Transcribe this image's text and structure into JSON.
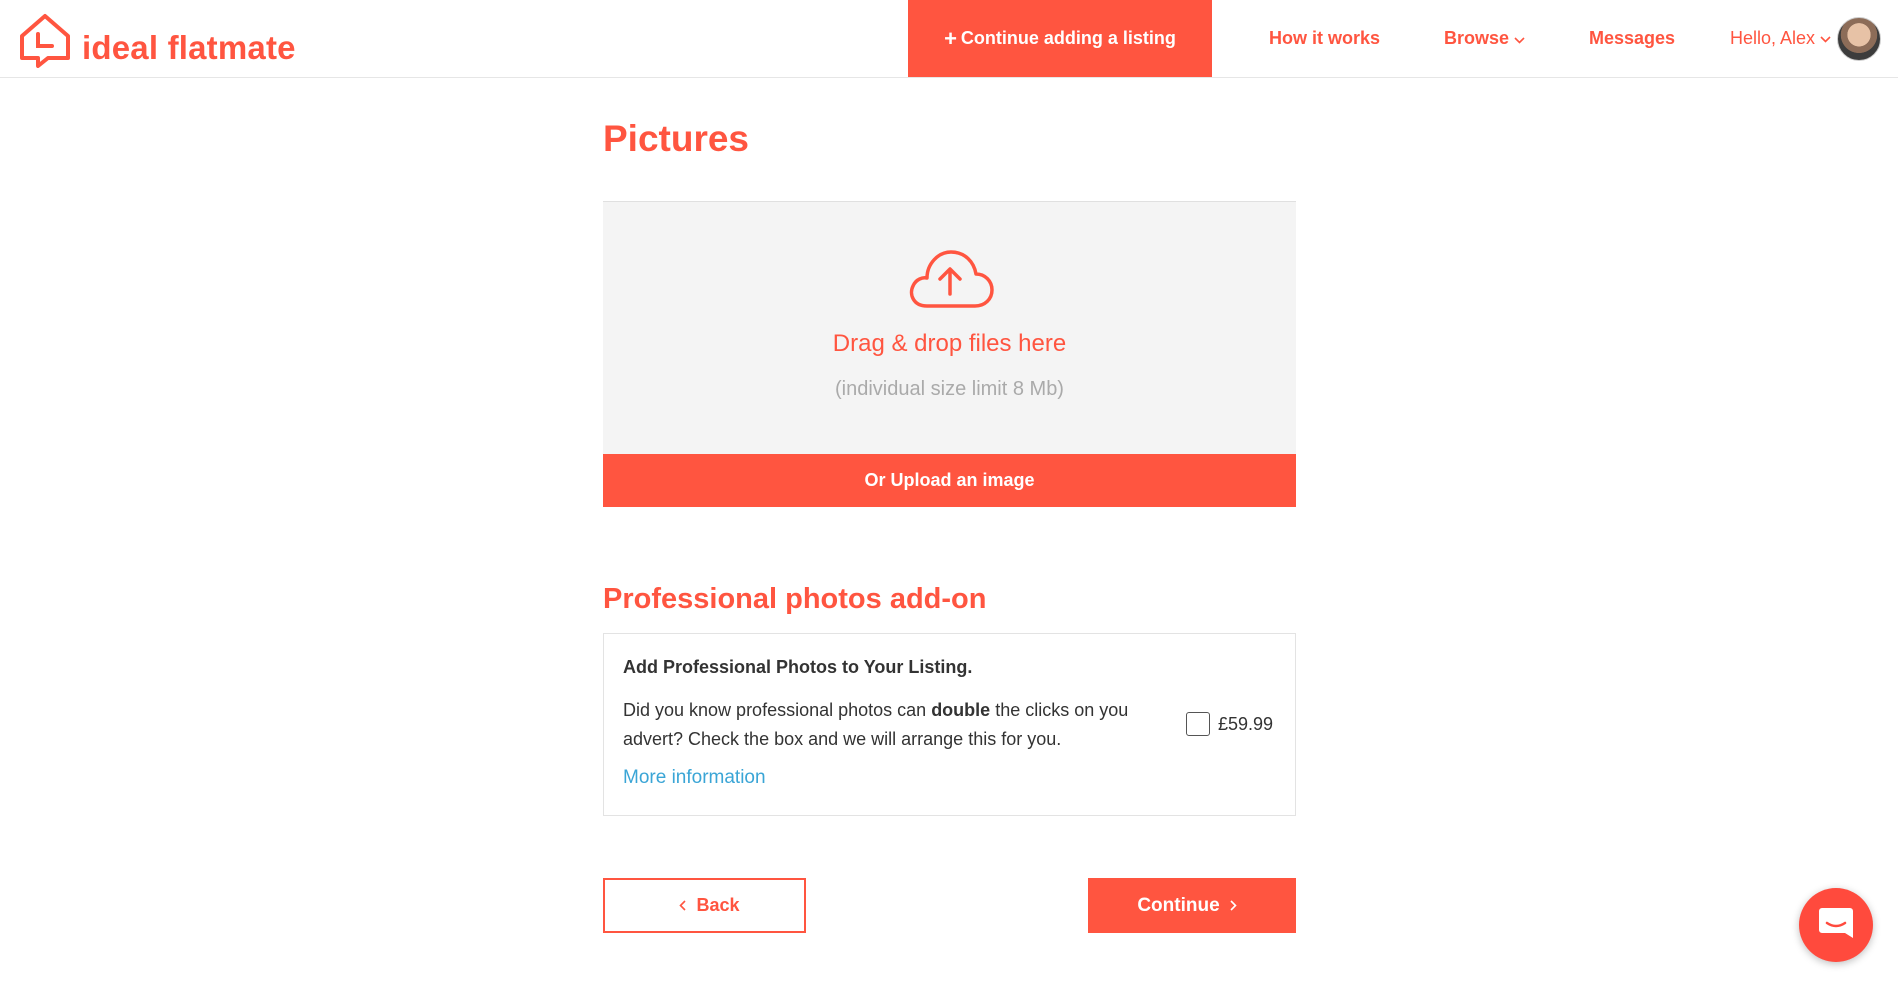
{
  "header": {
    "logo_text": "ideal flatmate",
    "cta_label": "Continue adding a listing",
    "nav": {
      "how_it_works": "How it works",
      "browse": "Browse",
      "messages": "Messages"
    },
    "user_label": "Hello, Alex"
  },
  "page": {
    "title": "Pictures",
    "dropzone": {
      "title": "Drag & drop files here",
      "subtitle": "(individual size limit 8 Mb)"
    },
    "upload_button": "Or Upload an image"
  },
  "addon": {
    "section_title": "Professional photos add-on",
    "heading": "Add Professional Photos to Your Listing.",
    "desc_before": "Did you know professional photos can ",
    "desc_bold": "double",
    "desc_after": " the clicks on you advert? Check the box and we will arrange this for you.",
    "link": "More information",
    "price": "£59.99",
    "checked": false
  },
  "actions": {
    "back": "Back",
    "continue": "Continue"
  },
  "colors": {
    "brand": "#ff5540",
    "link": "#3aa5d6"
  }
}
